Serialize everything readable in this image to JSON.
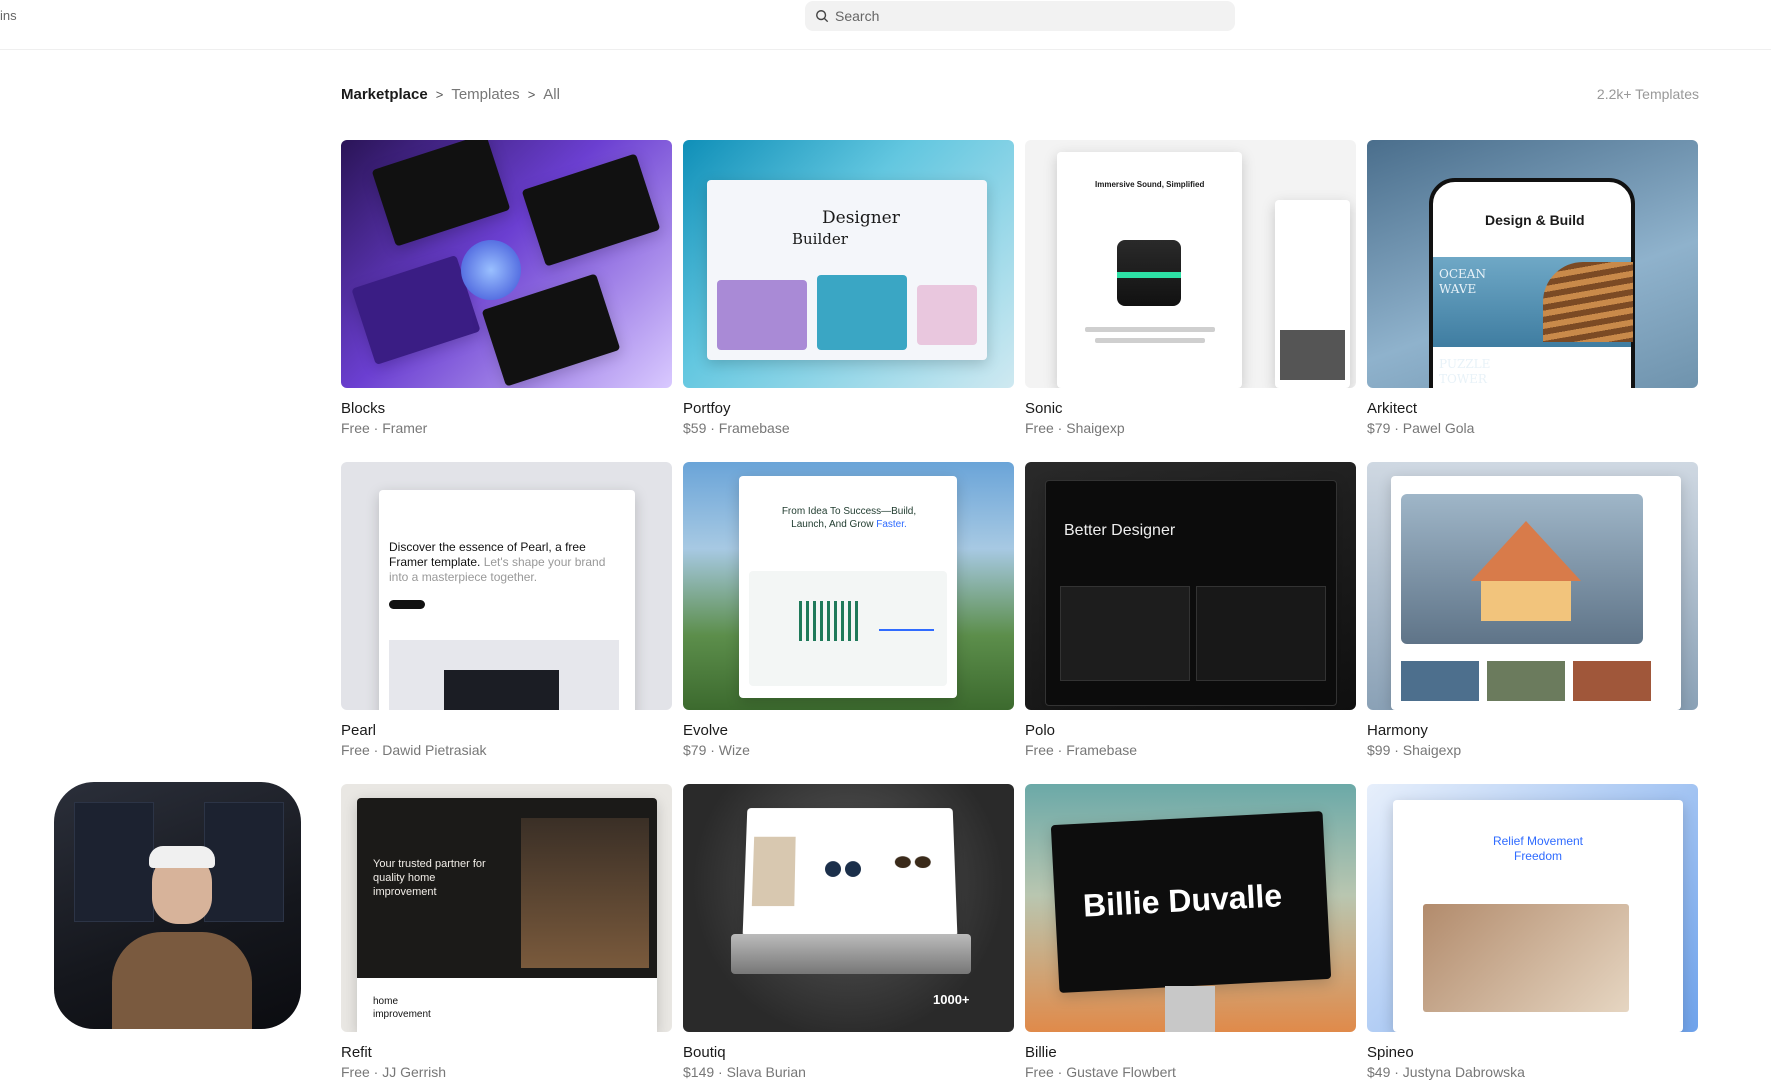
{
  "topbar": {
    "cut_label": "ins",
    "search_placeholder": "Search"
  },
  "breadcrumb": {
    "items": [
      "Marketplace",
      "Templates",
      "All"
    ],
    "separator": ">"
  },
  "templates_count": "2.2k+ Templates",
  "cards": [
    {
      "title": "Blocks",
      "meta": "Free · Framer"
    },
    {
      "title": "Portfoy",
      "meta": "$59 · Framebase"
    },
    {
      "title": "Sonic",
      "meta": "Free · Shaigexp"
    },
    {
      "title": "Arkitect",
      "meta": "$79 · Pawel Gola"
    },
    {
      "title": "Pearl",
      "meta": "Free · Dawid Pietrasiak"
    },
    {
      "title": "Evolve",
      "meta": "$79 · Wize"
    },
    {
      "title": "Polo",
      "meta": "Free · Framebase"
    },
    {
      "title": "Harmony",
      "meta": "$99 · Shaigexp"
    },
    {
      "title": "Refit",
      "meta": "Free · JJ Gerrish"
    },
    {
      "title": "Boutiq",
      "meta": "$149 · Slava Burian"
    },
    {
      "title": "Billie",
      "meta": "Free · Gustave Flowbert"
    },
    {
      "title": "Spineo",
      "meta": "$49 · Justyna Dabrowska"
    }
  ],
  "thumb_text": {
    "portfoy_heading_1": "Designer",
    "portfoy_heading_2": "Builder",
    "sonic_heading": "Immersive Sound, Simplified",
    "arkitect_heading": "Design & Build",
    "arkitect_ocean": "OCEAN WAVE",
    "arkitect_puzzle": "PUZZLE TOWER",
    "pearl_text": "Discover the essence of Pearl, a free Framer template.",
    "pearl_text_muted": "Let's shape your brand into a masterpiece together.",
    "evolve_heading": "From Idea To Success—Build, Launch, And Grow",
    "evolve_accent": "Faster.",
    "polo_heading": "Better Designer",
    "refit_heading": "Your trusted partner for quality home improvement",
    "refit_sub": "home improvement",
    "boutiq_badge": "1000+",
    "billie_heading": "Billie Duvalle",
    "spineo_heading": "Relief Movement Freedom"
  },
  "colors": {
    "accent_blue": "#2f6bff",
    "evolve_green": "#1f7a5a",
    "billie_orange": "#e08a4a"
  }
}
